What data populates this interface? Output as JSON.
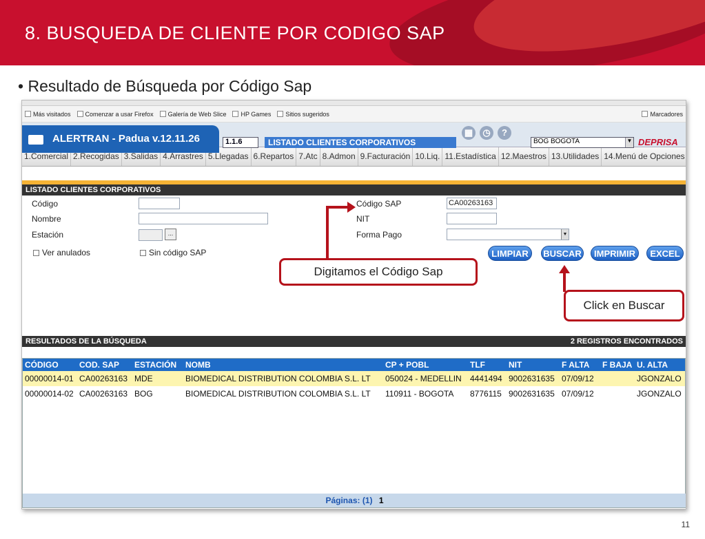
{
  "slide": {
    "title": "8.  BUSQUEDA DE CLIENTE POR CODIGO SAP",
    "bullet": "Resultado de  Búsqueda por  Código Sap",
    "page_number": "11"
  },
  "browser": {
    "bookmarks": [
      "Más visitados",
      "Comenzar a usar Firefox",
      "Galería de Web Slice",
      "HP Games",
      "Sitios sugeridos"
    ],
    "marcadores": "Marcadores"
  },
  "app": {
    "name": "ALERTRAN - Padua  v.12.11.26",
    "version": "1.1.6",
    "screen_title": "LISTADO CLIENTES CORPORATIVOS",
    "station": "BOG BOGOTA",
    "logo": "DEPRISA"
  },
  "menu": [
    "1.Comercial",
    "2.Recogidas",
    "3.Salidas",
    "4.Arrastres",
    "5.Llegadas",
    "6.Repartos",
    "7.Atc",
    "8.Admon",
    "9.Facturación",
    "10.Liq.",
    "11.Estadística",
    "12.Maestros",
    "13.Utilidades",
    "14.Menú de Opciones"
  ],
  "form": {
    "section_title": "LISTADO CLIENTES CORPORATIVOS",
    "codigo_label": "Código",
    "nombre_label": "Nombre",
    "estacion_label": "Estación",
    "ver_anulados": "Ver anulados",
    "sin_codigo_sap": "Sin código SAP",
    "codigo_sap_label": "Código SAP",
    "codigo_sap_value": "CA00263163",
    "nit_label": "NIT",
    "forma_pago_label": "Forma Pago",
    "dots": "...",
    "btn_limpiar": "LIMPIAR",
    "btn_buscar": "BUSCAR",
    "btn_imprimir": "IMPRIMIR",
    "btn_excel": "EXCEL"
  },
  "results": {
    "title": "RESULTADOS DE LA BÚSQUEDA",
    "count": "2  REGISTROS ENCONTRADOS",
    "columns": [
      "CÓDIGO",
      "COD. SAP",
      "ESTACIÓN",
      "NOMB",
      "CP + POBL",
      "TLF",
      "NIT",
      "F ALTA",
      "F BAJA",
      "U. ALTA"
    ],
    "rows": [
      [
        "00000014-01",
        "CA00263163",
        "MDE",
        "BIOMEDICAL DISTRIBUTION COLOMBIA S.L. LT",
        "050024 - MEDELLIN",
        "4441494",
        "9002631635",
        "07/09/12",
        "",
        "JGONZALO"
      ],
      [
        "00000014-02",
        "CA00263163",
        "BOG",
        "BIOMEDICAL DISTRIBUTION COLOMBIA S.L. LT",
        "110911 - BOGOTA",
        "8776115",
        "9002631635",
        "07/09/12",
        "",
        "JGONZALO"
      ]
    ],
    "pages_label": "Páginas: (1)",
    "page": "1"
  },
  "callouts": {
    "digitamos": "Digitamos el Código Sap",
    "click": "Click en Buscar"
  },
  "colors": {
    "brand_red": "#c8102e",
    "header_blue": "#1f6cc7",
    "highlight_row": "#fdf5b0"
  }
}
